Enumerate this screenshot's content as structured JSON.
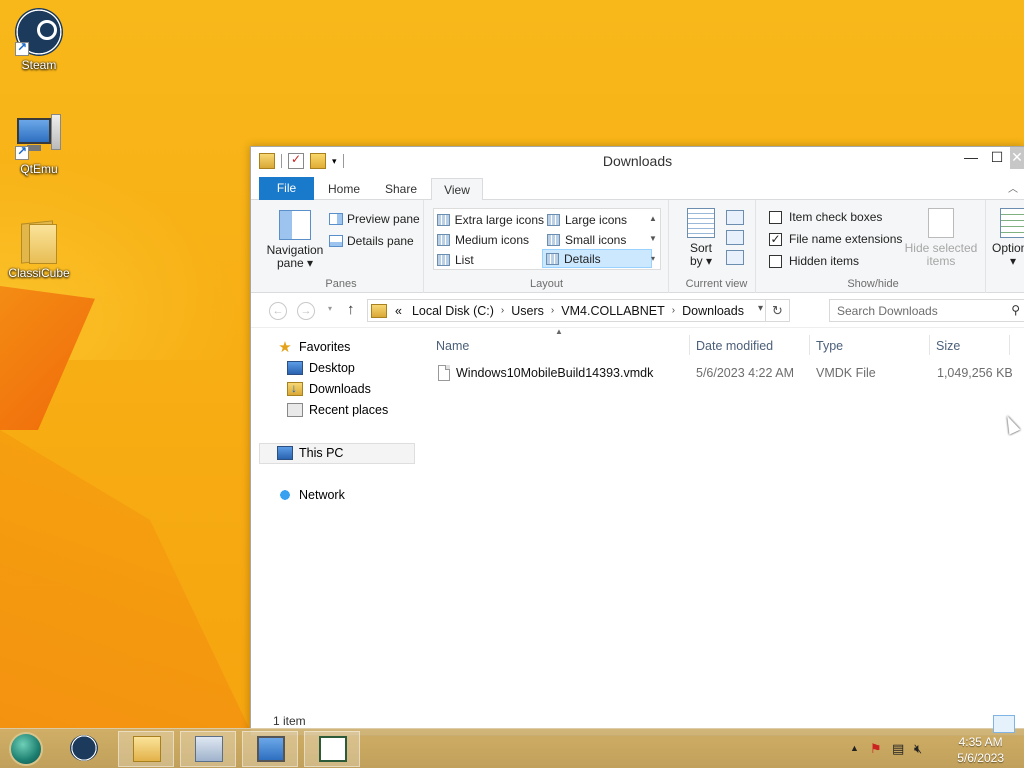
{
  "desktop": {
    "icons": [
      {
        "label": "Steam",
        "icon": "steam-icon"
      },
      {
        "label": "QtEmu",
        "icon": "monitor-icon"
      },
      {
        "label": "ClassiCube",
        "icon": "folder-icon"
      }
    ]
  },
  "window": {
    "title": "Downloads",
    "controls": {
      "minimize": "—",
      "maximize": "☐",
      "close": "✕"
    },
    "tabs": {
      "file": "File",
      "home": "Home",
      "share": "Share",
      "view": "View"
    },
    "active_tab": "View",
    "ribbon": {
      "panes": {
        "navigation_pane": "Navigation",
        "navigation_pane_2": "pane ▾",
        "preview_pane": "Preview pane",
        "details_pane": "Details pane",
        "label": "Panes"
      },
      "layout": {
        "extra_large": "Extra large icons",
        "large": "Large icons",
        "medium": "Medium icons",
        "small": "Small icons",
        "list": "List",
        "details": "Details",
        "selected": "Details",
        "label": "Layout"
      },
      "current_view": {
        "sort_by": "Sort",
        "sort_by_2": "by ▾",
        "label": "Current view"
      },
      "show_hide": {
        "item_check_boxes": "Item check boxes",
        "file_name_extensions": "File name extensions",
        "hidden_items": "Hidden items",
        "item_check_boxes_checked": false,
        "file_name_extensions_checked": true,
        "hidden_items_checked": false,
        "hide_selected": "Hide selected",
        "hide_selected_2": "items",
        "label": "Show/hide"
      },
      "options": {
        "label": "Options",
        "arrow": "▾"
      }
    },
    "address": {
      "overflow": "«",
      "crumbs": [
        "Local Disk (C:)",
        "Users",
        "VM4.COLLABNET",
        "Downloads"
      ]
    },
    "search": {
      "placeholder": "Search Downloads"
    },
    "nav_pane": {
      "favorites": "Favorites",
      "desktop": "Desktop",
      "downloads": "Downloads",
      "recent_places": "Recent places",
      "this_pc": "This PC",
      "network": "Network"
    },
    "columns": {
      "name": "Name",
      "date_modified": "Date modified",
      "type": "Type",
      "size": "Size"
    },
    "files": [
      {
        "name": "Windows10MobileBuild14393.vmdk",
        "date_modified": "5/6/2023 4:22 AM",
        "type": "VMDK File",
        "size": "1,049,256 KB"
      }
    ],
    "status": {
      "item_count": "1 item"
    }
  },
  "taskbar": {
    "clock_time": "4:35 AM",
    "clock_date": "5/6/2023",
    "tray_chevron": "▲"
  }
}
